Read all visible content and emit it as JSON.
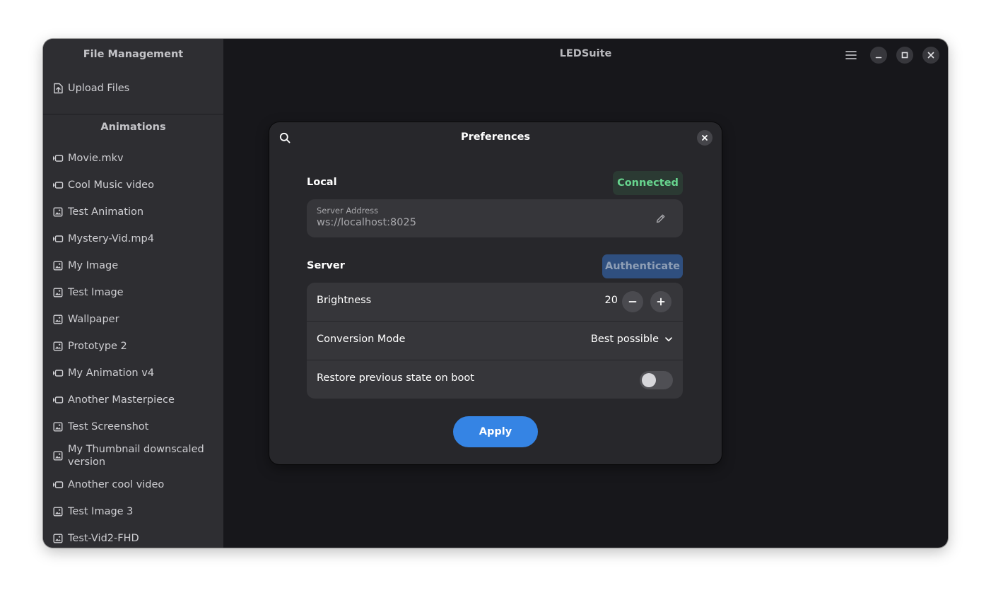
{
  "app": {
    "title": "LEDSuite"
  },
  "sidebar": {
    "file_management_heading": "File Management",
    "upload_label": "Upload Files",
    "animations_heading": "Animations",
    "items": [
      {
        "label": "Movie.mkv",
        "icon": "video-icon"
      },
      {
        "label": "Cool Music video",
        "icon": "video-icon"
      },
      {
        "label": "Test Animation",
        "icon": "image-icon"
      },
      {
        "label": "Mystery-Vid.mp4",
        "icon": "video-icon"
      },
      {
        "label": "My Image",
        "icon": "image-icon"
      },
      {
        "label": "Test Image",
        "icon": "image-icon"
      },
      {
        "label": "Wallpaper",
        "icon": "image-icon"
      },
      {
        "label": "Prototype 2",
        "icon": "image-icon"
      },
      {
        "label": "My Animation v4",
        "icon": "video-icon"
      },
      {
        "label": "Another Masterpiece",
        "icon": "video-icon"
      },
      {
        "label": "Test Screenshot",
        "icon": "image-icon"
      },
      {
        "label": "My Thumbnail downscaled version",
        "icon": "image-icon"
      },
      {
        "label": "Another cool video",
        "icon": "video-icon"
      },
      {
        "label": "Test Image 3",
        "icon": "image-icon"
      },
      {
        "label": "Test-Vid2-FHD",
        "icon": "image-icon"
      }
    ]
  },
  "header": {
    "menu_icon": "hamburger-menu-icon",
    "minimize_icon": "minimize-icon",
    "maximize_icon": "maximize-icon",
    "close_icon": "close-icon"
  },
  "preferences": {
    "title": "Preferences",
    "local": {
      "heading": "Local",
      "status": "Connected",
      "server_address_label": "Server Address",
      "server_address_value": "ws://localhost:8025"
    },
    "server": {
      "heading": "Server",
      "authenticate_label": "Authenticate",
      "brightness_label": "Brightness",
      "brightness_value": "20",
      "conversion_mode_label": "Conversion Mode",
      "conversion_mode_value": "Best possible",
      "restore_label": "Restore previous state on boot",
      "restore_enabled": false
    },
    "apply_label": "Apply"
  },
  "colors": {
    "accent": "#3584e4",
    "connected": "#67d48e",
    "authenticate_bg": "#2f4f7f",
    "window_bg": "#17171b",
    "sidebar_bg": "#2e2e32",
    "dialog_bg": "#27272b"
  }
}
